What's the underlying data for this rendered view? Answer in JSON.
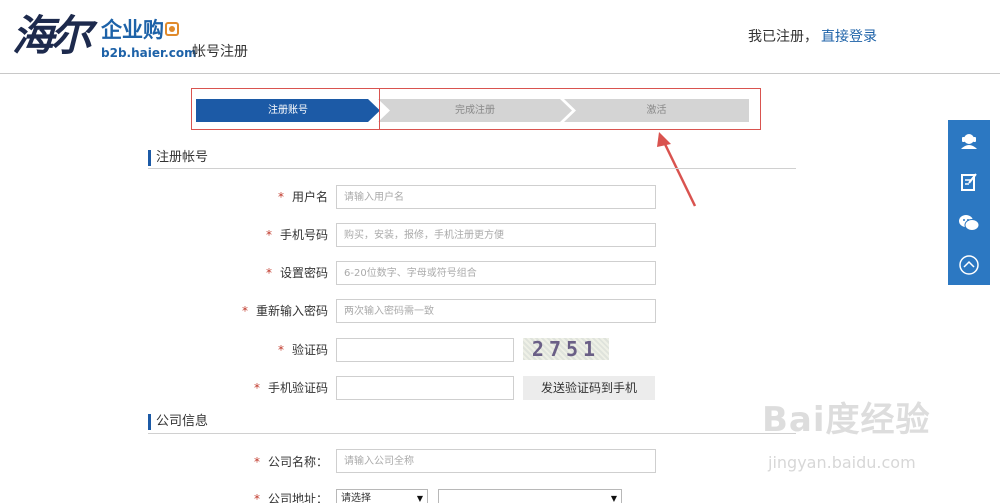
{
  "header": {
    "logo_script": "海尔",
    "logo_brand": "企业购",
    "logo_url": "b2b.haier.com",
    "page_subtitle": "帐号注册",
    "login_prompt": "我已注册，",
    "login_link": "直接登录"
  },
  "steps": [
    {
      "label": "注册账号",
      "state": "active"
    },
    {
      "label": "完成注册",
      "state": "inactive"
    },
    {
      "label": "激活",
      "state": "inactive"
    }
  ],
  "section_account": {
    "title": "注册帐号"
  },
  "form": {
    "username": {
      "label": "用户名",
      "placeholder": "请输入用户名",
      "value": ""
    },
    "phone": {
      "label": "手机号码",
      "placeholder": "购买，安装，报修，手机注册更方便",
      "value": ""
    },
    "password": {
      "label": "设置密码",
      "placeholder": "6-20位数字、字母或符号组合",
      "value": ""
    },
    "password_confirm": {
      "label": "重新输入密码",
      "placeholder": "两次输入密码需一致",
      "value": ""
    },
    "captcha": {
      "label": "验证码",
      "value": "",
      "code": "2751"
    },
    "sms_code": {
      "label": "手机验证码",
      "value": "",
      "button": "发送验证码到手机"
    }
  },
  "section_company": {
    "title": "公司信息"
  },
  "company": {
    "name": {
      "label": "公司名称：",
      "placeholder": "请输入公司全称",
      "value": ""
    },
    "address": {
      "label": "公司地址：",
      "select_value": "请选择",
      "select2_value": ""
    }
  },
  "required_mark": "*",
  "sidebar_icons": [
    "customer-service-icon",
    "edit-form-icon",
    "wechat-icon",
    "back-to-top-icon"
  ],
  "watermark": {
    "main": "Bai度经验",
    "url": "jingyan.baidu.com"
  },
  "colors": {
    "brand_blue": "#1c5aa6",
    "sidebar_blue": "#2c78c2",
    "annotation_red": "#d9534f"
  }
}
